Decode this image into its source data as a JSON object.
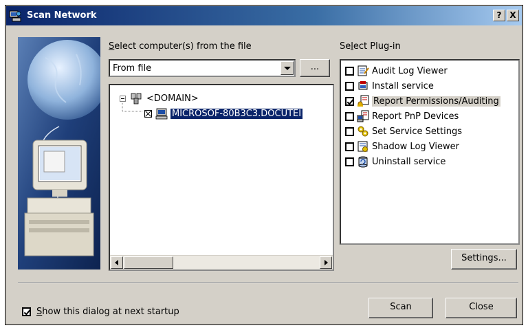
{
  "window": {
    "title": "Scan Network",
    "help_button": "?",
    "close_button": "X"
  },
  "computers": {
    "label_prefix": "S",
    "label_rest": "elect computer(s) from the file",
    "source_value": "From file",
    "browse_label": "...",
    "tree": {
      "domain_label": "<DOMAIN>",
      "computer_label": "MICROSOF-80B3C3.DOCUTEI"
    }
  },
  "plugins": {
    "label_prefix": "Se",
    "label_underline": "l",
    "label_rest": "ect Plug-in",
    "items": [
      {
        "label": "Audit Log Viewer",
        "checked": false
      },
      {
        "label": "Install service",
        "checked": false
      },
      {
        "label": "Report Permissions/Auditing",
        "checked": true
      },
      {
        "label": "Report PnP Devices",
        "checked": false
      },
      {
        "label": "Set Service Settings",
        "checked": false
      },
      {
        "label": "Shadow Log Viewer",
        "checked": false
      },
      {
        "label": "Uninstall service",
        "checked": false
      }
    ],
    "settings_label": "Settings..."
  },
  "footer": {
    "startup_prefix": "S",
    "startup_rest": "how this dialog at next startup",
    "startup_checked": true,
    "scan_label": "Scan",
    "close_label": "Close"
  }
}
